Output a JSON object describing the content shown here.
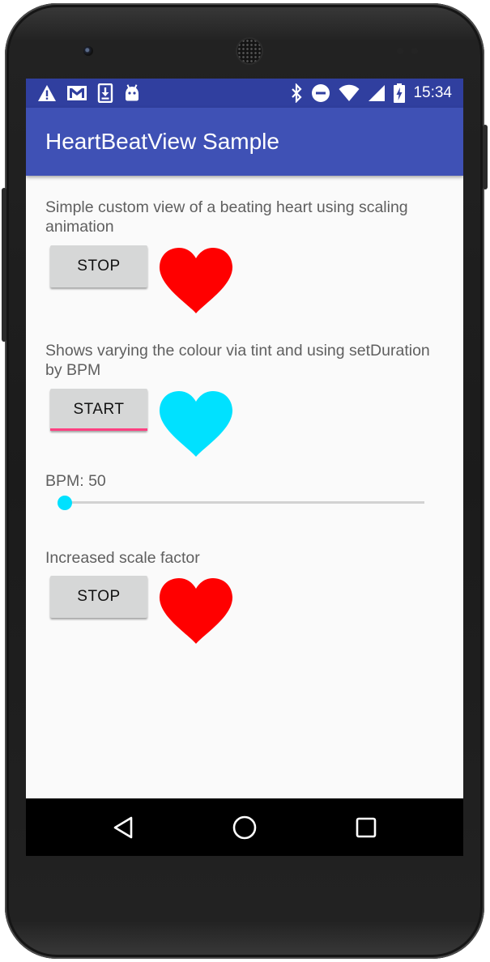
{
  "status_bar": {
    "time": "15:34",
    "left_icons": [
      "warning-icon",
      "gmail-icon",
      "download-icon",
      "android-icon"
    ],
    "right_icons": [
      "bluetooth-icon",
      "do-not-disturb-icon",
      "wifi-icon",
      "cellular-icon",
      "battery-charging-icon"
    ]
  },
  "app_bar": {
    "title": "HeartBeatView Sample"
  },
  "sections": [
    {
      "description": "Simple custom view of a beating heart using scaling animation",
      "button_label": "STOP",
      "heart_color": "#ff0000"
    },
    {
      "description": "Shows varying the colour via tint and using setDuration by BPM",
      "button_label": "START",
      "heart_color": "#00e1ff"
    },
    {
      "description": "Increased scale factor",
      "button_label": "STOP",
      "heart_color": "#ff0000"
    }
  ],
  "bpm": {
    "label": "BPM: 50",
    "value": 50
  },
  "colors": {
    "primary": "#3f51b5",
    "primary_dark": "#303f9f",
    "accent": "#ff4081",
    "seek_accent": "#00e1ff"
  },
  "nav_bar": {
    "buttons": [
      "back-icon",
      "home-icon",
      "recents-icon"
    ]
  }
}
